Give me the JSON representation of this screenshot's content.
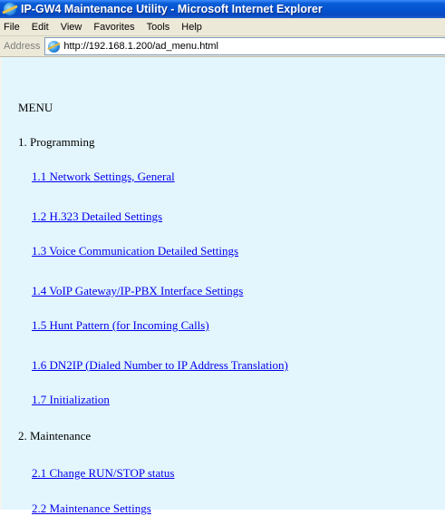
{
  "window": {
    "title": "IP-GW4 Maintenance Utility - Microsoft Internet Explorer"
  },
  "menubar": {
    "items": [
      "File",
      "Edit",
      "View",
      "Favorites",
      "Tools",
      "Help"
    ]
  },
  "address": {
    "label": "Address",
    "url": "http://192.168.1.200/ad_menu.html"
  },
  "content": {
    "heading": "MENU",
    "sections": [
      {
        "title": "1. Programming",
        "links": [
          "1.1 Network Settings, General",
          "1.2 H.323 Detailed Settings",
          "1.3 Voice Communication Detailed Settings",
          "1.4 VoIP Gateway/IP-PBX Interface Settings",
          "1.5 Hunt Pattern (for Incoming Calls)",
          "1.6 DN2IP (Dialed Number to IP Address Translation)",
          "1.7 Initialization"
        ]
      },
      {
        "title": "2. Maintenance",
        "links": [
          "2.1 Change RUN/STOP status",
          "2.2 Maintenance Settings"
        ]
      }
    ]
  }
}
